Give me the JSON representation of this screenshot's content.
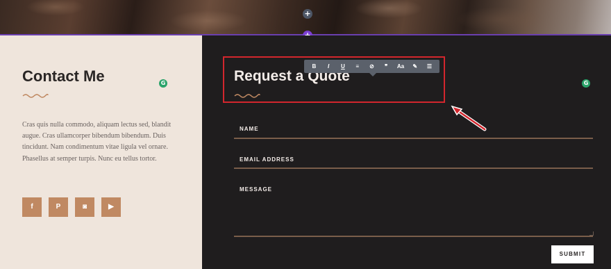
{
  "builder": {
    "add_row_icon": "plus-icon",
    "add_section_icon": "plus-icon",
    "divider_color": "#6a3fb0"
  },
  "contact": {
    "title": "Contact Me",
    "text": "Cras quis nulla commodo, aliquam lectus sed, blandit augue. Cras ullamcorper bibendum bibendum. Duis tincidunt. Nam condimentum vitae ligula vel ornare. Phasellus at semper turpis. Nunc eu tellus tortor.",
    "social": [
      {
        "name": "facebook-icon",
        "glyph": "f"
      },
      {
        "name": "pinterest-icon",
        "glyph": "P"
      },
      {
        "name": "instagram-icon",
        "glyph": "◙"
      },
      {
        "name": "youtube-icon",
        "glyph": "▶"
      }
    ],
    "accent_color": "#c08962"
  },
  "quote": {
    "title": "Request a Quote",
    "fields": [
      {
        "label": "NAME"
      },
      {
        "label": "EMAIL ADDRESS"
      },
      {
        "label": "MESSAGE"
      }
    ],
    "submit_label": "SUBMIT"
  },
  "toolbar": {
    "items": [
      {
        "glyph": "B",
        "icon": "bold-icon"
      },
      {
        "glyph": "I",
        "icon": "italic-icon"
      },
      {
        "glyph": "U",
        "icon": "underline-icon"
      },
      {
        "glyph": "≡",
        "icon": "align-icon"
      },
      {
        "glyph": "⊘",
        "icon": "link-icon"
      },
      {
        "glyph": "❞",
        "icon": "quote-icon"
      },
      {
        "glyph": "Aa",
        "icon": "text-size-icon"
      },
      {
        "glyph": "✎",
        "icon": "text-color-icon"
      },
      {
        "glyph": "☰",
        "icon": "list-icon"
      }
    ]
  },
  "annotation": {
    "highlight_color": "#d3262d"
  }
}
